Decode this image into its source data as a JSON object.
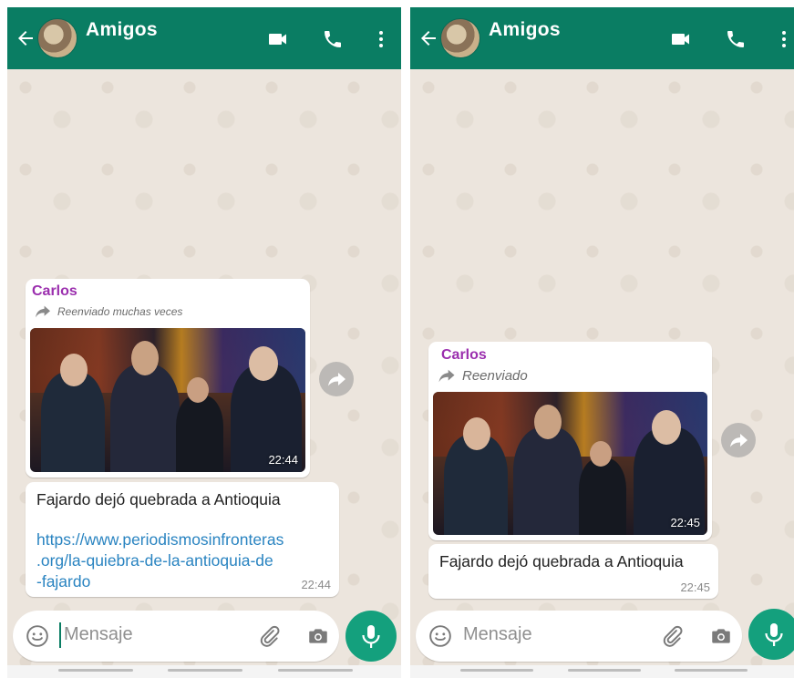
{
  "left": {
    "header": {
      "title": "Amigos"
    },
    "message": {
      "sender": "Carlos",
      "forwarded_label": "Reenviado muchas veces",
      "image_time": "22:44",
      "text": "Fajardo dejó quebrada a Antioquia",
      "link_lines": [
        "https://www.periodismosinfronteras",
        ".org/la-quiebra-de-la-antioquia-de",
        "-fajardo"
      ],
      "time": "22:44"
    },
    "input": {
      "placeholder": "Mensaje"
    }
  },
  "right": {
    "header": {
      "title": "Amigos"
    },
    "message": {
      "sender": "Carlos",
      "forwarded_label": "Reenviado",
      "image_time": "22:45",
      "text": "Fajardo dejó quebrada a Antioquia",
      "time": "22:45"
    },
    "input": {
      "placeholder": "Mensaje"
    }
  },
  "colors": {
    "header": "#0a7d63",
    "accent": "#14a07d",
    "sender": "#9b2fae",
    "link": "#2a84c1"
  },
  "icons": [
    "back-arrow-icon",
    "video-call-icon",
    "phone-icon",
    "more-vert-icon",
    "forward-icon",
    "share-icon",
    "emoji-icon",
    "attach-icon",
    "camera-icon",
    "mic-icon"
  ]
}
